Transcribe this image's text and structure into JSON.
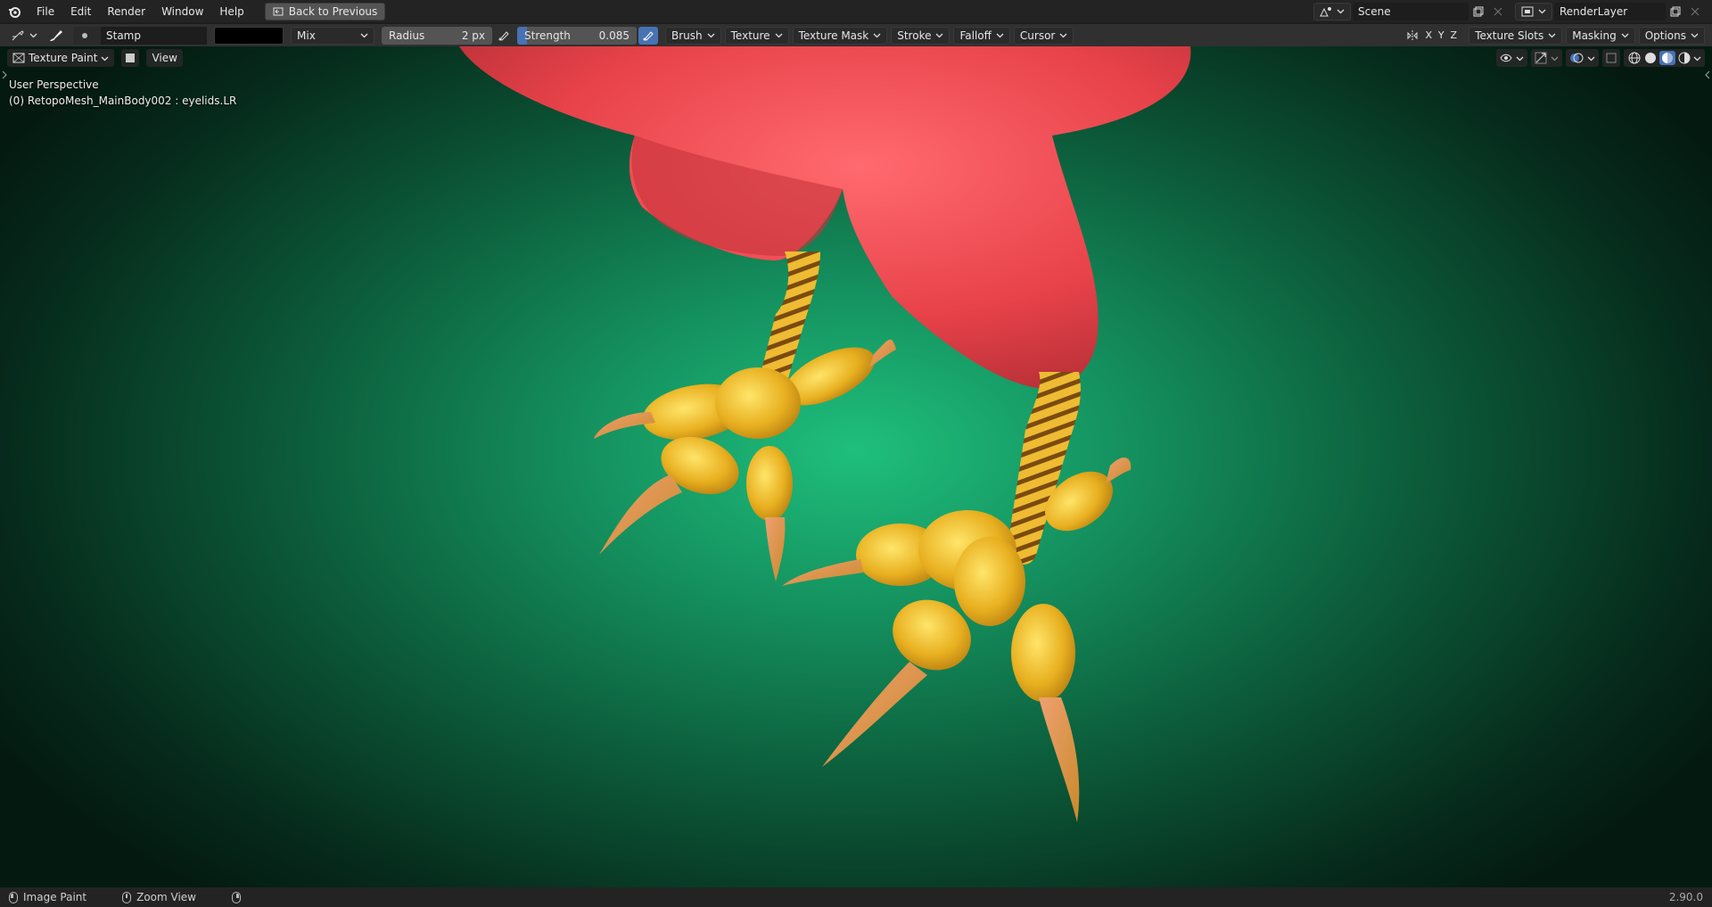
{
  "topbar": {
    "menus": [
      "File",
      "Edit",
      "Render",
      "Window",
      "Help"
    ],
    "back_button": "Back to Previous",
    "scene": "Scene",
    "render_layer": "RenderLayer"
  },
  "toolbar": {
    "brush_name": "Stamp",
    "color_hex": "#000000",
    "blend_mode": "Mix",
    "radius_label": "Radius",
    "radius_value": "2 px",
    "strength_label": "Strength",
    "strength_value": "0.085",
    "strength_fraction": 0.085,
    "menus": [
      "Brush",
      "Texture",
      "Texture Mask",
      "Stroke",
      "Falloff",
      "Cursor"
    ],
    "axes": [
      "X",
      "Y",
      "Z"
    ],
    "right_menus": [
      "Texture Slots",
      "Masking",
      "Options"
    ]
  },
  "viewport": {
    "mode": "Texture Paint",
    "view_menu": "View",
    "perspective": "User Perspective",
    "object_info": "(0) RetopoMesh_MainBody002 : eyelids.LR"
  },
  "statusbar": {
    "items": [
      "Image Paint",
      "Zoom View"
    ],
    "version": "2.90.0"
  },
  "colors": {
    "accent": "#4772b3",
    "body_red": "#e8424a",
    "feet_yellow": "#e8b020",
    "background_green": "#1fbf7d"
  }
}
